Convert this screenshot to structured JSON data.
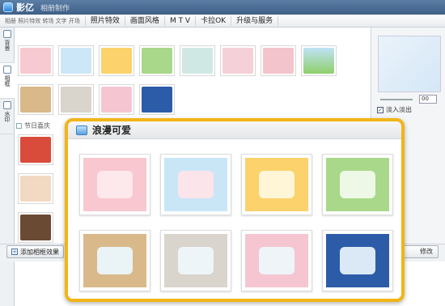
{
  "app": {
    "title": "影亿",
    "subtitle": "相册制作"
  },
  "menu": [
    {
      "label": "相册 照片特效 转场 文字 开场",
      "dim": true
    },
    {
      "label": "照片特效",
      "dim": false
    },
    {
      "label": "画面风格",
      "dim": false
    },
    {
      "label": "M T V",
      "dim": false
    },
    {
      "label": "卡拉OK",
      "dim": false
    },
    {
      "label": "升级与服务",
      "dim": false
    }
  ],
  "side_tabs": [
    {
      "label": "背景"
    },
    {
      "label": "相框"
    },
    {
      "label": "水印"
    }
  ],
  "section": {
    "label": "节日喜庆"
  },
  "buttons": {
    "add_effect": "添加相框效果",
    "modify": "修改"
  },
  "right_panel": {
    "value": "00",
    "checkbox_label": "淡入淡出",
    "checked": true
  },
  "popup": {
    "title": "浪漫可爱",
    "frames": [
      {
        "name": "pink-hearts",
        "bg": "#f9c7cf",
        "win": "#fde8ec"
      },
      {
        "name": "colorful-hearts",
        "bg": "#c9e6f7",
        "win": "#fbe4ea"
      },
      {
        "name": "flowers-orange",
        "bg": "#fbd26b",
        "win": "#fff6d8"
      },
      {
        "name": "green-hearts",
        "bg": "#a9d88a",
        "win": "#eef8e6"
      },
      {
        "name": "autumn-leaves",
        "bg": "#d9b98a",
        "win": "#eaf3f5"
      },
      {
        "name": "tag-flower",
        "bg": "#d9d4cc",
        "win": "#eef5f8"
      },
      {
        "name": "sakura-butterfly",
        "bg": "#f5c6d2",
        "win": "#eef4f8"
      },
      {
        "name": "blue-ornament",
        "bg": "#2c5ca8",
        "win": "#dbe8f6"
      }
    ]
  },
  "colors": {
    "popup_border": "#f2b516",
    "accent_blue": "#3f5f86"
  }
}
